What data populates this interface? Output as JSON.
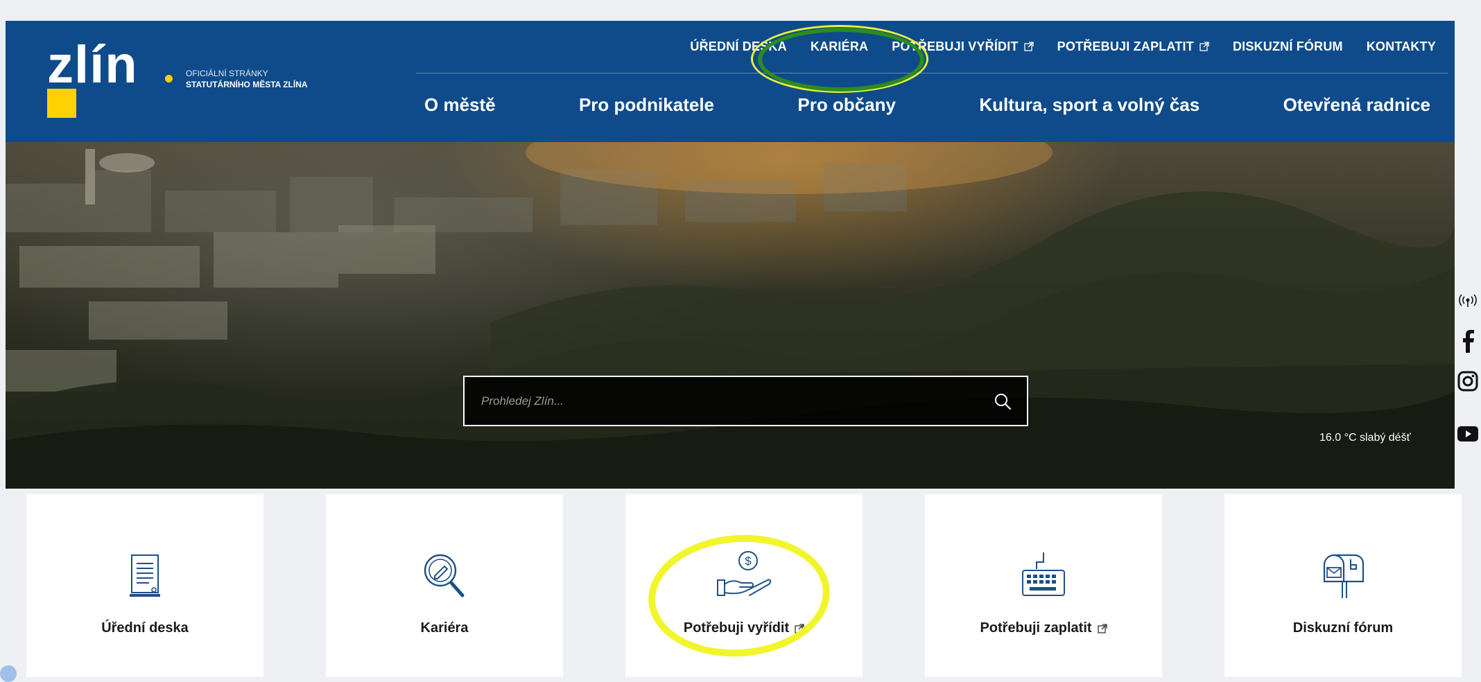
{
  "colors": {
    "header_bg": "#0f4b8a",
    "logo_accent": "#ffd100",
    "highlight_green": "#2e8b1e",
    "highlight_yellow": "#f1f52c",
    "icon_blue": "#1d4f86"
  },
  "logo": {
    "word": "zlín",
    "line1": "OFICIÁLNÍ STRÁNKY",
    "line2": "STATUTÁRNÍHO MĚSTA ZLÍNA"
  },
  "top_nav": [
    {
      "label": "ÚŘEDNÍ DESKA",
      "external": false
    },
    {
      "label": "KARIÉRA",
      "external": false
    },
    {
      "label": "POTŘEBUJI VYŘÍDIT",
      "external": true
    },
    {
      "label": "POTŘEBUJI ZAPLATIT",
      "external": true
    },
    {
      "label": "DISKUZNÍ FÓRUM",
      "external": false
    },
    {
      "label": "KONTAKTY",
      "external": false
    }
  ],
  "main_nav": [
    {
      "label": "O městě"
    },
    {
      "label": "Pro podnikatele"
    },
    {
      "label": "Pro občany"
    },
    {
      "label": "Kultura, sport a volný čas"
    },
    {
      "label": "Otevřená radnice"
    }
  ],
  "search": {
    "placeholder": "Prohledej Zlín...",
    "icon": "search-icon"
  },
  "weather": {
    "text": "16.0 °C slabý déšť"
  },
  "social": [
    {
      "name": "podcast-icon"
    },
    {
      "name": "facebook-icon"
    },
    {
      "name": "instagram-icon"
    },
    {
      "name": "youtube-icon"
    }
  ],
  "cards": [
    {
      "label": "Úřední deska",
      "icon": "notice-board-icon",
      "external": false
    },
    {
      "label": "Kariéra",
      "icon": "career-icon",
      "external": false
    },
    {
      "label": "Potřebuji vyřídit",
      "icon": "hand-coin-icon",
      "external": true
    },
    {
      "label": "Potřebuji zaplatit",
      "icon": "keyboard-icon",
      "external": true
    },
    {
      "label": "Diskuzní fórum",
      "icon": "mailbox-icon",
      "external": false
    }
  ]
}
